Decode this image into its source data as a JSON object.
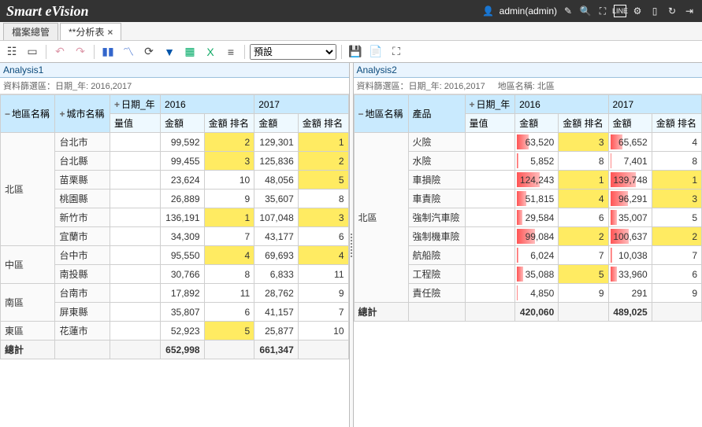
{
  "app_title": "Smart eVision",
  "user_label": "admin(admin)",
  "tabs": [
    {
      "label": "檔案總管",
      "active": false,
      "closable": false
    },
    {
      "label": "**分析表",
      "active": true,
      "closable": true
    }
  ],
  "toolbar": {
    "preset_label": "預設"
  },
  "panes": [
    {
      "title": "Analysis1",
      "filter_prefix": "資料篩選區：",
      "filters": [
        {
          "label": "日期_年: 2016,2017"
        }
      ],
      "dim_headers": {
        "region": "地區名稱",
        "city": "城市名稱",
        "year": "日期_年",
        "measure": "量值",
        "amount": "金額",
        "rank": "金額 排名"
      },
      "years": [
        "2016",
        "2017"
      ],
      "groups": [
        {
          "region": "北區",
          "rows": [
            {
              "city": "台北市",
              "y2016": {
                "amount": "99,592",
                "rank": 2,
                "hl": true
              },
              "y2017": {
                "amount": "129,301",
                "rank": 1,
                "hl": true
              }
            },
            {
              "city": "台北縣",
              "y2016": {
                "amount": "99,455",
                "rank": 3,
                "hl": true
              },
              "y2017": {
                "amount": "125,836",
                "rank": 2,
                "hl": true
              }
            },
            {
              "city": "苗栗縣",
              "y2016": {
                "amount": "23,624",
                "rank": 10,
                "hl": false
              },
              "y2017": {
                "amount": "48,056",
                "rank": 5,
                "hl": true
              }
            },
            {
              "city": "桃園縣",
              "y2016": {
                "amount": "26,889",
                "rank": 9,
                "hl": false
              },
              "y2017": {
                "amount": "35,607",
                "rank": 8,
                "hl": false
              }
            },
            {
              "city": "新竹市",
              "y2016": {
                "amount": "136,191",
                "rank": 1,
                "hl": true
              },
              "y2017": {
                "amount": "107,048",
                "rank": 3,
                "hl": true
              }
            },
            {
              "city": "宜蘭市",
              "y2016": {
                "amount": "34,309",
                "rank": 7,
                "hl": false
              },
              "y2017": {
                "amount": "43,177",
                "rank": 6,
                "hl": false
              }
            }
          ]
        },
        {
          "region": "中區",
          "rows": [
            {
              "city": "台中市",
              "y2016": {
                "amount": "95,550",
                "rank": 4,
                "hl": true
              },
              "y2017": {
                "amount": "69,693",
                "rank": 4,
                "hl": true
              }
            },
            {
              "city": "南投縣",
              "y2016": {
                "amount": "30,766",
                "rank": 8,
                "hl": false
              },
              "y2017": {
                "amount": "6,833",
                "rank": 11,
                "hl": false
              }
            }
          ]
        },
        {
          "region": "南區",
          "rows": [
            {
              "city": "台南市",
              "y2016": {
                "amount": "17,892",
                "rank": 11,
                "hl": false
              },
              "y2017": {
                "amount": "28,762",
                "rank": 9,
                "hl": false
              }
            },
            {
              "city": "屏東縣",
              "y2016": {
                "amount": "35,807",
                "rank": 6,
                "hl": false
              },
              "y2017": {
                "amount": "41,157",
                "rank": 7,
                "hl": false
              }
            }
          ]
        },
        {
          "region": "東區",
          "rows": [
            {
              "city": "花蓮市",
              "y2016": {
                "amount": "52,923",
                "rank": 5,
                "hl": true
              },
              "y2017": {
                "amount": "25,877",
                "rank": 10,
                "hl": false
              }
            }
          ]
        }
      ],
      "total": {
        "label": "總計",
        "y2016": "652,998",
        "y2017": "661,347"
      }
    },
    {
      "title": "Analysis2",
      "filter_prefix": "資料篩選區：",
      "filters": [
        {
          "label": "日期_年: 2016,2017"
        },
        {
          "label": "地區名稱: 北區"
        }
      ],
      "dim_headers": {
        "region": "地區名稱",
        "product": "產品",
        "year": "日期_年",
        "measure": "量值",
        "amount": "金額",
        "rank": "金額 排名"
      },
      "years": [
        "2016",
        "2017"
      ],
      "region": "北區",
      "max": 140000,
      "rows": [
        {
          "product": "火險",
          "y2016": {
            "amount": "63,520",
            "n": 63520,
            "rank": 3,
            "hl": true
          },
          "y2017": {
            "amount": "65,652",
            "n": 65652,
            "rank": 4,
            "hl": false
          }
        },
        {
          "product": "水險",
          "y2016": {
            "amount": "5,852",
            "n": 5852,
            "rank": 8,
            "hl": false
          },
          "y2017": {
            "amount": "7,401",
            "n": 7401,
            "rank": 8,
            "hl": false
          }
        },
        {
          "product": "車損險",
          "y2016": {
            "amount": "124,243",
            "n": 124243,
            "rank": 1,
            "hl": true
          },
          "y2017": {
            "amount": "139,748",
            "n": 139748,
            "rank": 1,
            "hl": true
          }
        },
        {
          "product": "車責險",
          "y2016": {
            "amount": "51,815",
            "n": 51815,
            "rank": 4,
            "hl": true
          },
          "y2017": {
            "amount": "96,291",
            "n": 96291,
            "rank": 3,
            "hl": true
          }
        },
        {
          "product": "強制汽車險",
          "y2016": {
            "amount": "29,584",
            "n": 29584,
            "rank": 6,
            "hl": false
          },
          "y2017": {
            "amount": "35,007",
            "n": 35007,
            "rank": 5,
            "hl": false
          }
        },
        {
          "product": "強制機車險",
          "y2016": {
            "amount": "99,084",
            "n": 99084,
            "rank": 2,
            "hl": true
          },
          "y2017": {
            "amount": "100,637",
            "n": 100637,
            "rank": 2,
            "hl": true
          }
        },
        {
          "product": "航船險",
          "y2016": {
            "amount": "6,024",
            "n": 6024,
            "rank": 7,
            "hl": false
          },
          "y2017": {
            "amount": "10,038",
            "n": 10038,
            "rank": 7,
            "hl": false
          }
        },
        {
          "product": "工程險",
          "y2016": {
            "amount": "35,088",
            "n": 35088,
            "rank": 5,
            "hl": true
          },
          "y2017": {
            "amount": "33,960",
            "n": 33960,
            "rank": 6,
            "hl": false
          }
        },
        {
          "product": "責任險",
          "y2016": {
            "amount": "4,850",
            "n": 4850,
            "rank": 9,
            "hl": false
          },
          "y2017": {
            "amount": "291",
            "n": 291,
            "rank": 9,
            "hl": false
          }
        }
      ],
      "total": {
        "label": "總計",
        "y2016": "420,060",
        "y2017": "489,025"
      }
    }
  ]
}
